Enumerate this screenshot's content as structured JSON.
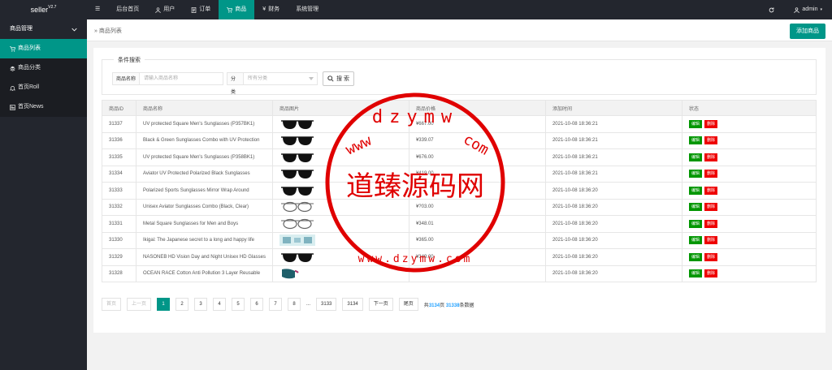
{
  "app": {
    "name": "seller",
    "version": "V2.7"
  },
  "nav": {
    "menu_icon": "menu-icon",
    "items": [
      {
        "label": "后台首页",
        "icon": ""
      },
      {
        "label": "用户",
        "icon": "user-icon"
      },
      {
        "label": "订单",
        "icon": "document-icon"
      },
      {
        "label": "商品",
        "icon": "cart-icon",
        "active": true
      },
      {
        "label": "财务",
        "icon": "yen-icon"
      },
      {
        "label": "系统管理",
        "icon": ""
      }
    ],
    "refresh_icon": "refresh-icon",
    "admin_label": "admin"
  },
  "sidebar": {
    "group": "商品管理",
    "items": [
      {
        "label": "商品列表",
        "icon": "cart-icon",
        "active": true
      },
      {
        "label": "商品分类",
        "icon": "layers-icon"
      },
      {
        "label": "首页Roll",
        "icon": "bell-icon"
      },
      {
        "label": "首页News",
        "icon": "news-icon"
      }
    ]
  },
  "breadcrumb": {
    "sep": "»",
    "current": "商品列表"
  },
  "add_button": "添加商品",
  "filter": {
    "legend": "条件搜索",
    "name_label": "商品名称",
    "name_placeholder": "请输入商品名称",
    "category_label": "分类",
    "category_placeholder": "所有分类",
    "search_button": "搜 索"
  },
  "table": {
    "headers": [
      "商品ID",
      "商品名称",
      "商品图片",
      "商品价格",
      "添加时间",
      "状态"
    ],
    "rows": [
      {
        "id": "31337",
        "name": "UV protected Square Men's Sunglasses (P357BK1)",
        "price": "¥667.00",
        "time": "2021-10-08 18:36:21",
        "thumb": "sunglasses-thumb"
      },
      {
        "id": "31336",
        "name": "Black & Green Sunglasses Combo with UV Protection",
        "price": "¥339.07",
        "time": "2021-10-08 18:36:21",
        "thumb": "sunglasses-thumb"
      },
      {
        "id": "31335",
        "name": "UV protected Square Men's Sunglasses (P358BK1)",
        "price": "¥676.00",
        "time": "2021-10-08 18:36:21",
        "thumb": "sunglasses-thumb"
      },
      {
        "id": "31334",
        "name": "Aviator UV Protected Polarized Black Sunglasses",
        "price": "¥419.00",
        "time": "2021-10-08 18:36:21",
        "thumb": "sunglasses-thumb"
      },
      {
        "id": "31333",
        "name": "Polarized Sports Sunglasses Mirror Wrap Around",
        "price": "",
        "time": "2021-10-08 18:36:20",
        "thumb": "sunglasses-thumb"
      },
      {
        "id": "31332",
        "name": "Unisex Aviator Sunglasses Combo (Black, Clear)",
        "price": "¥?03.00",
        "time": "2021-10-08 18:36:20",
        "thumb": "glasses-thumb"
      },
      {
        "id": "31331",
        "name": "Metal Square Sunglasses for Men and Boys",
        "price": "¥348.01",
        "time": "2021-10-08 18:36:20",
        "thumb": "glasses-thumb"
      },
      {
        "id": "31330",
        "name": "Ikigai: The Japanese secret to a long and happy life",
        "price": "¥365.00",
        "time": "2021-10-08 18:36:20",
        "thumb": "book-thumb"
      },
      {
        "id": "31329",
        "name": "NASONEB HD Vision Day and Night Unisex HD Glasses",
        "price": "¥349.00",
        "time": "2021-10-08 18:36:20",
        "thumb": "sunglasses-thumb"
      },
      {
        "id": "31328",
        "name": "OCEAN RACE Cotton Anti Pollution 3 Layer Reusable",
        "price": "",
        "time": "2021-10-08 18:36:20",
        "thumb": "mask-thumb"
      }
    ],
    "edit_label": "编辑",
    "delete_label": "删除"
  },
  "pagination": {
    "first": "首页",
    "prev": "上一页",
    "pages": [
      "1",
      "2",
      "3",
      "4",
      "5",
      "6",
      "7",
      "8"
    ],
    "current": "1",
    "ellipsis": "...",
    "tail_pages": [
      "3133",
      "3134"
    ],
    "next": "下一页",
    "last": "尾页",
    "info_prefix": "共",
    "total_pages": "3134",
    "info_mid": "页 ",
    "total_items": "31338",
    "info_suffix": "条数据"
  },
  "watermark": {
    "center": "道臻源码网",
    "top_ring": "dzymw",
    "side_left": "www",
    "side_right": "com",
    "bottom": "www.dzymw.com"
  },
  "colors": {
    "accent": "#009688",
    "dark": "#23262e",
    "edit": "#009600",
    "delete": "#ee0000",
    "stamp": "#e00000"
  }
}
